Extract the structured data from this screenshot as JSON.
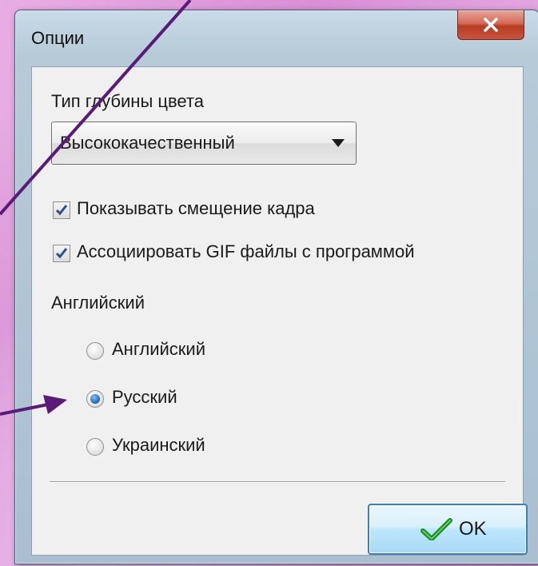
{
  "window": {
    "title": "Опции",
    "close_symbol": "x"
  },
  "color_depth": {
    "label": "Тип глубины цвета",
    "selected": "Высококачественный"
  },
  "options": [
    {
      "label": "Показывать смещение кадра",
      "checked": true
    },
    {
      "label": "Ассоциировать GIF файлы с программой",
      "checked": true
    }
  ],
  "language": {
    "label": "Английский",
    "choices": [
      {
        "label": "Английский",
        "selected": false
      },
      {
        "label": "Русский",
        "selected": true
      },
      {
        "label": "Украинский",
        "selected": false
      }
    ]
  },
  "buttons": {
    "ok_label": "OK"
  },
  "icons": {
    "close": "close-icon",
    "dropdown": "chevron-down-icon",
    "ok": "checkmark-icon",
    "checkbox": "checkmark-icon"
  },
  "colors": {
    "annotation": "#5a1a78",
    "background": "#e0a0dd",
    "close_button": "#c8553f",
    "ok_border": "#3c7fb1"
  }
}
